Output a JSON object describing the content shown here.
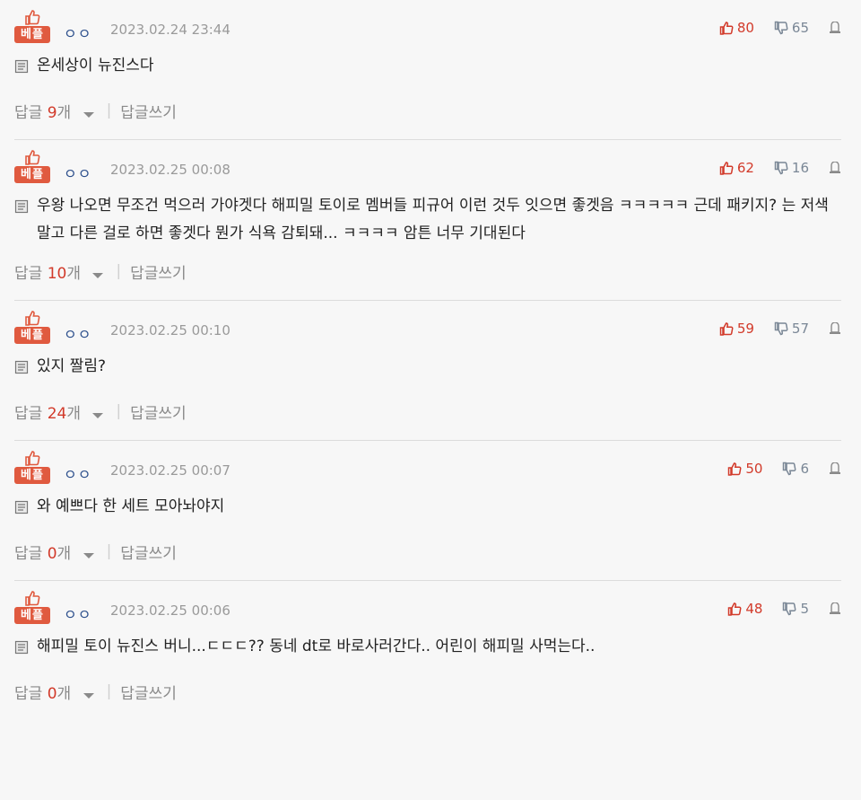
{
  "best_label": "베플",
  "reply_label": "답글",
  "reply_unit": "개",
  "write_reply_label": "답글쓰기",
  "comments": [
    {
      "handle": "ㅇㅇ",
      "date": "2023.02.24 23:44",
      "likes": "80",
      "dislikes": "65",
      "text": "온세상이 뉴진스다",
      "replies": "9"
    },
    {
      "handle": "ㅇㅇ",
      "date": "2023.02.25 00:08",
      "likes": "62",
      "dislikes": "16",
      "text": "우왕 나오면 무조건 먹으러 가야겟다 해피밀 토이로 멤버들 피규어 이런 것두 잇으면 좋겟음 ㅋㅋㅋㅋㅋ 근데 패키지? 는 저색 말고 다른 걸로 하면 좋겟다 뭔가 식욕 감퇴돼... ㅋㅋㅋㅋ 암튼 너무 기대된다",
      "replies": "10"
    },
    {
      "handle": "ㅇㅇ",
      "date": "2023.02.25 00:10",
      "likes": "59",
      "dislikes": "57",
      "text": "있지 짤림?",
      "replies": "24"
    },
    {
      "handle": "ㅇㅇ",
      "date": "2023.02.25 00:07",
      "likes": "50",
      "dislikes": "6",
      "text": "와 예쁘다 한 세트 모아놔야지",
      "replies": "0"
    },
    {
      "handle": "ㅇㅇ",
      "date": "2023.02.25 00:06",
      "likes": "48",
      "dislikes": "5",
      "text": "해피밀 토이 뉴진스 버니...ㄷㄷㄷ?? 동네 dt로 바로사러간다.. 어린이 해피밀 사먹는다..",
      "replies": "0"
    }
  ]
}
